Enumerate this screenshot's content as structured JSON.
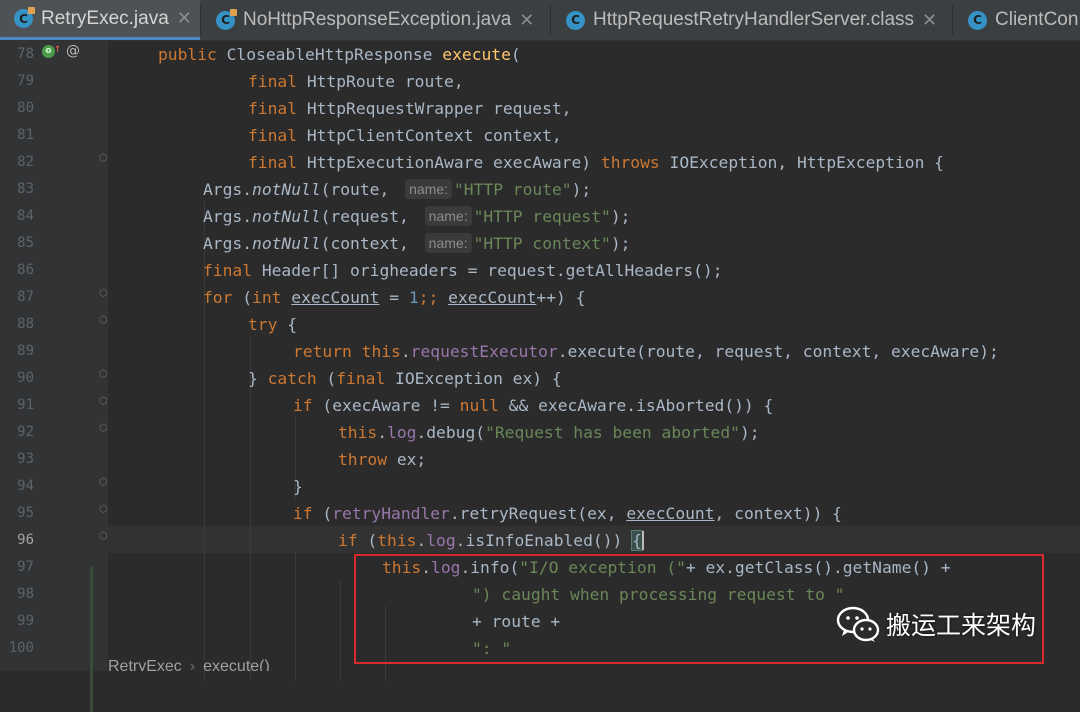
{
  "tabs": [
    {
      "label": "RetryExec.java",
      "active": true,
      "closable": true,
      "icon": "class-icon"
    },
    {
      "label": "NoHttpResponseException.java",
      "active": false,
      "closable": true,
      "icon": "class-icon"
    },
    {
      "label": "HttpRequestRetryHandlerServer.class",
      "active": false,
      "closable": true,
      "icon": "class-icon"
    },
    {
      "label": "ClientCon",
      "active": false,
      "closable": false,
      "icon": "class-icon"
    }
  ],
  "close_glyph": "✕",
  "gutter": {
    "line_numbers": [
      "78",
      "79",
      "80",
      "81",
      "82",
      "83",
      "84",
      "85",
      "86",
      "87",
      "88",
      "89",
      "90",
      "91",
      "92",
      "93",
      "94",
      "95",
      "96",
      "97",
      "98",
      "99",
      "100"
    ],
    "current_line": "96",
    "marker_override_glyph": "o",
    "marker_arrow_glyph": "↑",
    "marker_annotation_glyph": "@"
  },
  "code": {
    "l78": {
      "kw1": "public",
      "t1": " CloseableHttpResponse ",
      "fn": "execute",
      "t2": "("
    },
    "l79": {
      "kw": "final",
      "t": " HttpRoute route,"
    },
    "l80": {
      "kw": "final",
      "t": " HttpRequestWrapper request,"
    },
    "l81": {
      "kw": "final",
      "t": " HttpClientContext context,"
    },
    "l82": {
      "kw": "final",
      "t1": " HttpExecutionAware execAware) ",
      "kw2": "throws",
      "t2": " IOException, HttpException {"
    },
    "l83": {
      "t1": "Args.",
      "m": "notNull",
      "t2": "(route, ",
      "hint": "name:",
      "s": "\"HTTP route\"",
      "t3": ");"
    },
    "l84": {
      "t1": "Args.",
      "m": "notNull",
      "t2": "(request, ",
      "hint": "name:",
      "s": "\"HTTP request\"",
      "t3": ");"
    },
    "l85": {
      "t1": "Args.",
      "m": "notNull",
      "t2": "(context, ",
      "hint": "name:",
      "s": "\"HTTP context\"",
      "t3": ");"
    },
    "l86": {
      "kw": "final",
      "t": " Header[] origheaders = request.getAllHeaders();"
    },
    "l87": {
      "kw1": "for",
      "t1": " (",
      "kw2": "int",
      "t2": " ",
      "v1": "execCount",
      "t3": " = ",
      "n": "1",
      "t4": ";; ",
      "v2": "execCount",
      "t5": "++) {"
    },
    "l88": {
      "kw": "try",
      "t": " {"
    },
    "l89": {
      "kw1": "return",
      "t1": " ",
      "kw2": "this",
      "t2": ".",
      "f": "requestExecutor",
      "t3": ".execute(route, request, context, execAware);"
    },
    "l90": {
      "t1": "} ",
      "kw1": "catch",
      "t2": " (",
      "kw2": "final",
      "t3": " IOException ex) {"
    },
    "l91": {
      "kw1": "if",
      "t1": " (execAware != ",
      "kw2": "null",
      "t2": " && execAware.isAborted()) {"
    },
    "l92": {
      "kw": "this",
      "t1": ".",
      "f": "log",
      "t2": ".debug(",
      "s": "\"Request has been aborted\"",
      "t3": ");"
    },
    "l93": {
      "kw": "throw",
      "t": " ex;"
    },
    "l94": {
      "t": "}"
    },
    "l95": {
      "kw": "if",
      "t1": " (",
      "f": "retryHandler",
      "t2": ".retryRequest(ex, ",
      "v": "execCount",
      "t3": ", context)) {"
    },
    "l96": {
      "kw1": "if",
      "t1": " (",
      "kw2": "this",
      "t2": ".",
      "f": "log",
      "t3": ".isInfoEnabled()) ",
      "b": "{"
    },
    "l97": {
      "kw": "this",
      "t1": ".",
      "f": "log",
      "t2": ".info(",
      "s": "\"I/O exception (\"",
      "t3": "+ ex.getClass().getName() +"
    },
    "l98": {
      "s": "\") caught when processing request to \""
    },
    "l99": {
      "t": "+ route +"
    },
    "l100": {
      "s": "\": \""
    }
  },
  "breadcrumb": {
    "class": "RetryExec",
    "separator": "›",
    "method": "execute()"
  },
  "watermark": {
    "text": "搬运工来架构",
    "icon": "wechat-icon"
  },
  "colors": {
    "background": "#2b2b2b",
    "gutter": "#313335",
    "keyword": "#cc7832",
    "field": "#9876aa",
    "string": "#6a8759",
    "number": "#6897bb",
    "text": "#a9b7c6",
    "tab_active_underline": "#4a88c7",
    "highlight_box": "#d92b2b"
  }
}
